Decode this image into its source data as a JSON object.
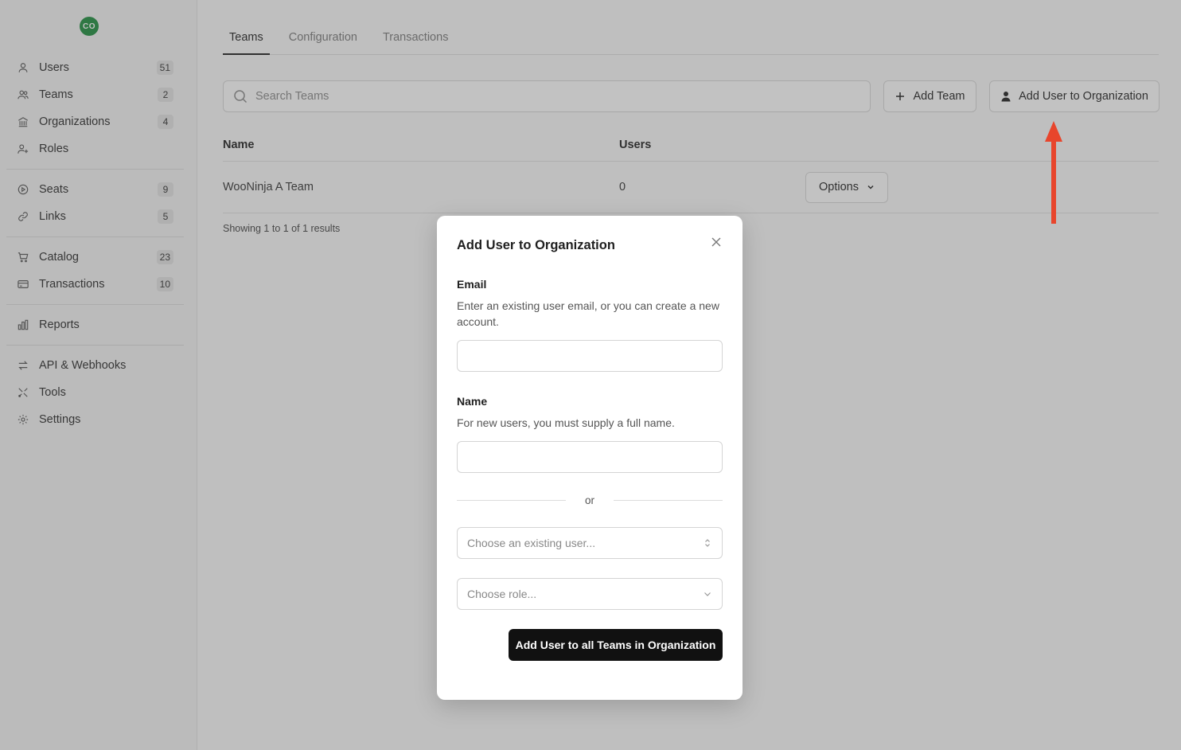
{
  "sidebar": {
    "avatar_initials": "CO",
    "items": [
      {
        "label": "Users",
        "count": "51",
        "icon": "user-icon"
      },
      {
        "label": "Teams",
        "count": "2",
        "icon": "users-icon"
      },
      {
        "label": "Organizations",
        "count": "4",
        "icon": "building-icon"
      },
      {
        "label": "Roles",
        "count": "",
        "icon": "user-plus-icon"
      },
      {
        "label": "Seats",
        "count": "9",
        "icon": "play-circle-icon"
      },
      {
        "label": "Links",
        "count": "5",
        "icon": "link-icon"
      },
      {
        "label": "Catalog",
        "count": "23",
        "icon": "cart-icon"
      },
      {
        "label": "Transactions",
        "count": "10",
        "icon": "credit-card-icon"
      },
      {
        "label": "Reports",
        "count": "",
        "icon": "bar-chart-icon"
      },
      {
        "label": "API & Webhooks",
        "count": "",
        "icon": "arrows-icon"
      },
      {
        "label": "Tools",
        "count": "",
        "icon": "tools-icon"
      },
      {
        "label": "Settings",
        "count": "",
        "icon": "gear-icon"
      }
    ]
  },
  "tabs": [
    {
      "label": "Teams",
      "active": true
    },
    {
      "label": "Configuration",
      "active": false
    },
    {
      "label": "Transactions",
      "active": false
    }
  ],
  "search": {
    "placeholder": "Search Teams"
  },
  "toolbar": {
    "add_team_label": "Add Team",
    "add_user_label": "Add User to Organization"
  },
  "table": {
    "columns": [
      "Name",
      "Users"
    ],
    "rows": [
      {
        "name": "WooNinja A Team",
        "users": "0",
        "options_label": "Options"
      }
    ],
    "footer": "Showing 1 to 1 of 1 results"
  },
  "modal": {
    "title": "Add User to Organization",
    "email_label": "Email",
    "email_help": "Enter an existing user email, or you can create a new account.",
    "email_value": "",
    "name_label": "Name",
    "name_help": "For new users, you must supply a full name.",
    "name_value": "",
    "or_text": "or",
    "existing_user_placeholder": "Choose an existing user...",
    "role_placeholder": "Choose role...",
    "submit_label": "Add User to all Teams in Organization"
  },
  "colors": {
    "avatar": "#1e8e3e",
    "annotation_arrow": "#e8452c",
    "primary_button": "#111111"
  }
}
